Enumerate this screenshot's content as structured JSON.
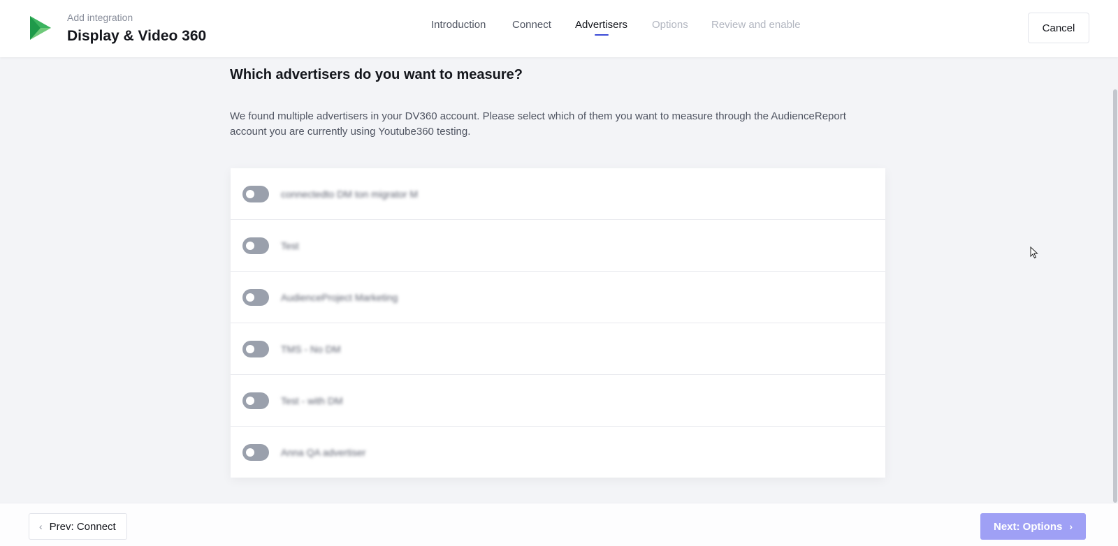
{
  "header": {
    "subtitle": "Add integration",
    "title": "Display & Video 360",
    "logo_icon": "play-logo-icon",
    "cancel_label": "Cancel"
  },
  "steps": [
    {
      "label": "Introduction",
      "state": "done"
    },
    {
      "label": "Connect",
      "state": "done"
    },
    {
      "label": "Advertisers",
      "state": "active"
    },
    {
      "label": "Options",
      "state": "future"
    },
    {
      "label": "Review and enable",
      "state": "future"
    }
  ],
  "main": {
    "question": "Which advertisers do you want to measure?",
    "description": "We found multiple advertisers in your DV360 account. Please select which of them you want to measure through the AudienceReport account you are currently using Youtube360 testing.",
    "advertisers": [
      {
        "name": "connectedto DM ton migrator M",
        "enabled": false
      },
      {
        "name": "Test",
        "enabled": false
      },
      {
        "name": "AudienceProject Marketing",
        "enabled": false
      },
      {
        "name": "TMS - No DM",
        "enabled": false
      },
      {
        "name": "Test - with DM",
        "enabled": false
      },
      {
        "name": "Anna QA advertiser",
        "enabled": false
      }
    ]
  },
  "footer": {
    "prev_label": "Prev: Connect",
    "next_label": "Next: Options"
  },
  "colors": {
    "accent": "#3b4ad6",
    "next_button": "#9fa0f5",
    "logo_green": "#34a853",
    "toggle_off": "#9aa0ac"
  }
}
